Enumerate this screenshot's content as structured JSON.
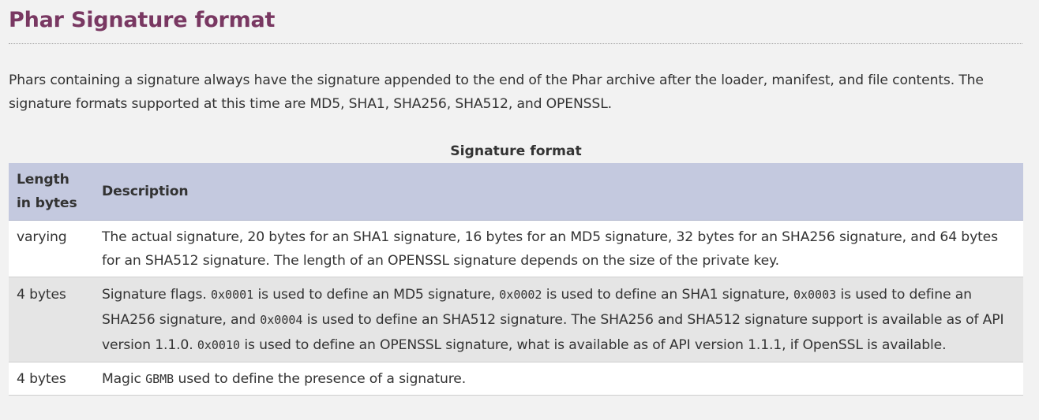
{
  "heading": "Phar Signature format",
  "intro": "Phars containing a signature always have the signature appended to the end of the Phar archive after the loader, manifest, and file contents. The signature formats supported at this time are MD5, SHA1, SHA256, SHA512, and OPENSSL.",
  "table": {
    "caption": "Signature format",
    "headers": {
      "length": "Length in bytes",
      "description": "Description"
    },
    "rows": [
      {
        "length": "varying",
        "description": "The actual signature, 20 bytes for an SHA1 signature, 16 bytes for an MD5 signature, 32 bytes for an SHA256 signature, and 64 bytes for an SHA512 signature. The length of an OPENSSL signature depends on the size of the private key."
      },
      {
        "length": "4 bytes",
        "desc_parts": {
          "p1": "Signature flags. ",
          "c1": "0x0001",
          "p2": " is used to define an MD5 signature, ",
          "c2": "0x0002",
          "p3": " is used to define an SHA1 signature, ",
          "c3": "0x0003",
          "p4": " is used to define an SHA256 signature, and ",
          "c4": "0x0004",
          "p5": " is used to define an SHA512 signature. The SHA256 and SHA512 signature support is available as of API version 1.1.0. ",
          "c5": "0x0010",
          "p6": " is used to define an OPENSSL signature, what is available as of API version 1.1.1, if OpenSSL is available."
        }
      },
      {
        "length": "4 bytes",
        "desc_parts": {
          "p1": "Magic ",
          "c1": "GBMB",
          "p2": " used to define the presence of a signature."
        }
      }
    ]
  }
}
